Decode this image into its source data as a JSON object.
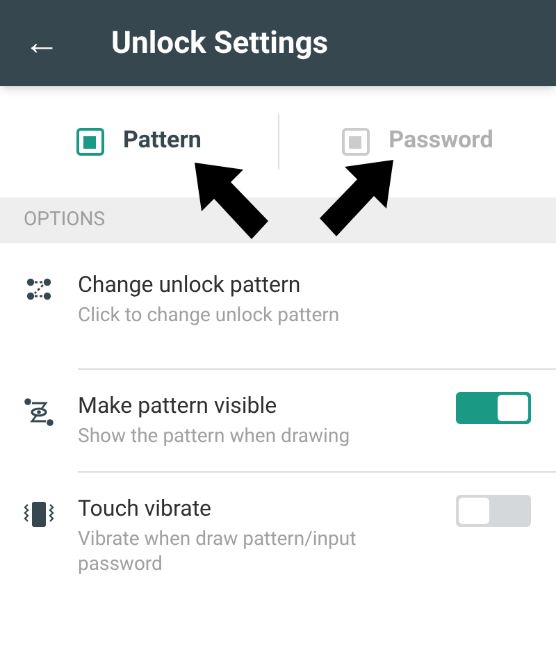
{
  "header": {
    "back": "←",
    "title": "Unlock Settings"
  },
  "tabs": [
    {
      "label": "Pattern",
      "selected": true
    },
    {
      "label": "Password",
      "selected": false
    }
  ],
  "section": "OPTIONS",
  "options": [
    {
      "kind": "link",
      "title": "Change unlock pattern",
      "subtitle": "Click to change unlock pattern"
    },
    {
      "kind": "toggle",
      "title": "Make pattern visible",
      "subtitle": "Show the pattern when drawing",
      "on": true
    },
    {
      "kind": "toggle",
      "title": "Touch vibrate",
      "subtitle": "Vibrate when draw pattern/input password",
      "on": false
    }
  ]
}
